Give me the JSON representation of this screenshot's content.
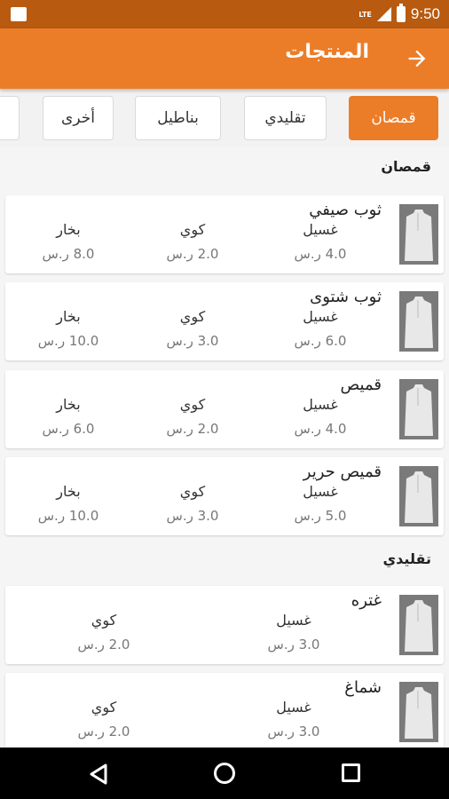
{
  "status_bar": {
    "network": "LTE",
    "time": "9:50"
  },
  "app_bar": {
    "title": "المنتجات"
  },
  "chips": [
    {
      "label": "قمصان",
      "active": true
    },
    {
      "label": "تقليدي",
      "active": false
    },
    {
      "label": "بناطيل",
      "active": false
    },
    {
      "label": "أخرى",
      "active": false
    }
  ],
  "sections": [
    {
      "title": "قمصان",
      "items": [
        {
          "name": "ثوب صيفي",
          "services": [
            {
              "label": "غسيل",
              "price": "4.0 ر.س"
            },
            {
              "label": "كوي",
              "price": "2.0 ر.س"
            },
            {
              "label": "بخار",
              "price": "8.0 ر.س"
            }
          ]
        },
        {
          "name": "ثوب شتوى",
          "services": [
            {
              "label": "غسيل",
              "price": "6.0 ر.س"
            },
            {
              "label": "كوي",
              "price": "3.0 ر.س"
            },
            {
              "label": "بخار",
              "price": "10.0 ر.س"
            }
          ]
        },
        {
          "name": "قميص",
          "services": [
            {
              "label": "غسيل",
              "price": "4.0 ر.س"
            },
            {
              "label": "كوي",
              "price": "2.0 ر.س"
            },
            {
              "label": "بخار",
              "price": "6.0 ر.س"
            }
          ]
        },
        {
          "name": "قميص حرير",
          "services": [
            {
              "label": "غسيل",
              "price": "5.0 ر.س"
            },
            {
              "label": "كوي",
              "price": "3.0 ر.س"
            },
            {
              "label": "بخار",
              "price": "10.0 ر.س"
            }
          ]
        }
      ]
    },
    {
      "title": "تقليدي",
      "items": [
        {
          "name": "غتره",
          "services": [
            {
              "label": "غسيل",
              "price": "3.0 ر.س"
            },
            {
              "label": "كوي",
              "price": "2.0 ر.س"
            }
          ]
        },
        {
          "name": "شماغ",
          "services": [
            {
              "label": "غسيل",
              "price": "3.0 ر.س"
            },
            {
              "label": "كوي",
              "price": "2.0 ر.س"
            }
          ]
        }
      ]
    }
  ],
  "icons": {
    "back": "arrow-forward-icon",
    "product": "thobe-image"
  },
  "colors": {
    "primary": "#ec7d28",
    "status_bar": "#b85a10"
  }
}
